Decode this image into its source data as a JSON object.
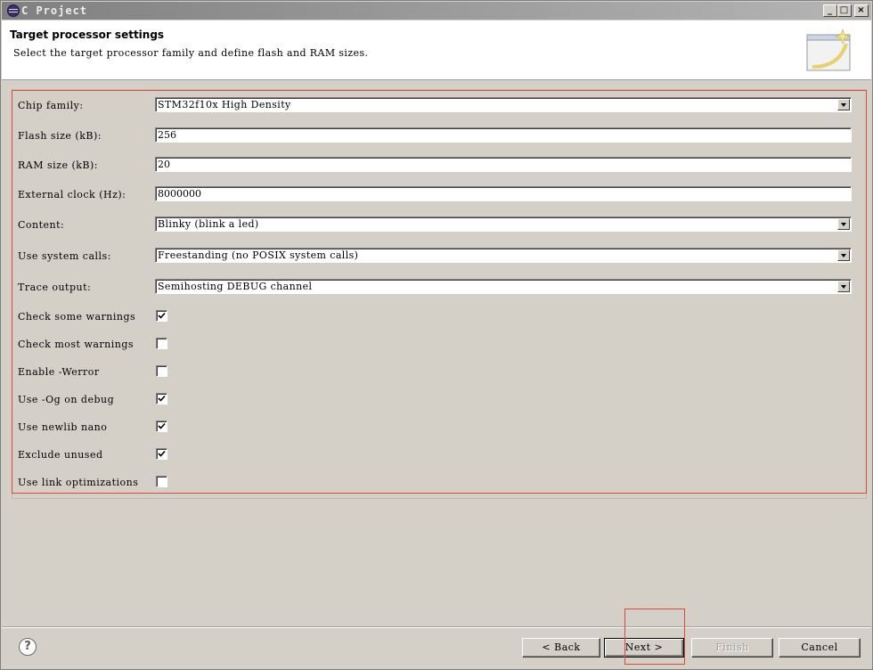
{
  "window": {
    "title": "C Project"
  },
  "header": {
    "title": "Target processor settings",
    "description": "Select the target processor family and define flash and RAM sizes."
  },
  "form": {
    "chip_family": {
      "label": "Chip family:",
      "value": "STM32f10x High Density"
    },
    "flash_size": {
      "label": "Flash size (kB):",
      "value": "256"
    },
    "ram_size": {
      "label": "RAM size (kB):",
      "value": "20"
    },
    "external_clock": {
      "label": "External clock (Hz):",
      "value": "8000000"
    },
    "content": {
      "label": "Content:",
      "value": "Blinky (blink a led)"
    },
    "system_calls": {
      "label": "Use system calls:",
      "value": "Freestanding (no POSIX system calls)"
    },
    "trace_output": {
      "label": "Trace output:",
      "value": "Semihosting DEBUG channel"
    },
    "checkboxes": [
      {
        "label": "Check some warnings",
        "checked": true
      },
      {
        "label": "Check most warnings",
        "checked": false
      },
      {
        "label": "Enable -Werror",
        "checked": false
      },
      {
        "label": "Use -Og on debug",
        "checked": true
      },
      {
        "label": "Use newlib nano",
        "checked": true
      },
      {
        "label": "Exclude unused",
        "checked": true
      },
      {
        "label": "Use link optimizations",
        "checked": false
      }
    ]
  },
  "buttons": {
    "help": "?",
    "back": "< Back",
    "next": "Next >",
    "finish": "Finish",
    "cancel": "Cancel"
  },
  "colors": {
    "highlight": "#e0463a",
    "dialog_bg": "#d4d0c8"
  }
}
